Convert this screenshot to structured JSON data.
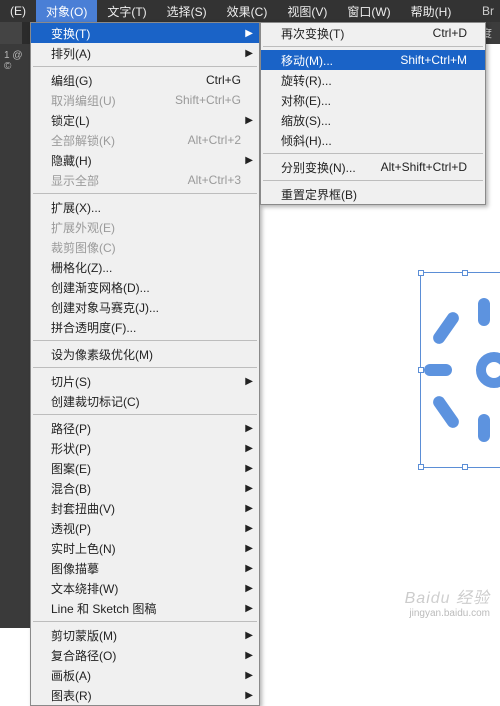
{
  "menubar": {
    "items": [
      {
        "label": "(E)"
      },
      {
        "label": "对象(O)"
      },
      {
        "label": "文字(T)"
      },
      {
        "label": "选择(S)"
      },
      {
        "label": "效果(C)"
      },
      {
        "label": "视图(V)"
      },
      {
        "label": "窗口(W)"
      },
      {
        "label": "帮助(H)"
      }
    ],
    "active_index": 1
  },
  "toolbar": {
    "right_hint_top": "Br",
    "right_hint_mid": "明度",
    "left_text": "1 @ ©"
  },
  "menu1": [
    {
      "type": "item",
      "label": "变换(T)",
      "sub": true,
      "hl": true
    },
    {
      "type": "item",
      "label": "排列(A)",
      "sub": true
    },
    {
      "type": "sep"
    },
    {
      "type": "item",
      "label": "编组(G)",
      "sc": "Ctrl+G"
    },
    {
      "type": "item",
      "label": "取消编组(U)",
      "sc": "Shift+Ctrl+G",
      "disabled": true
    },
    {
      "type": "item",
      "label": "锁定(L)",
      "sub": true
    },
    {
      "type": "item",
      "label": "全部解锁(K)",
      "sc": "Alt+Ctrl+2",
      "disabled": true
    },
    {
      "type": "item",
      "label": "隐藏(H)",
      "sub": true
    },
    {
      "type": "item",
      "label": "显示全部",
      "sc": "Alt+Ctrl+3",
      "disabled": true
    },
    {
      "type": "sep"
    },
    {
      "type": "item",
      "label": "扩展(X)..."
    },
    {
      "type": "item",
      "label": "扩展外观(E)",
      "disabled": true
    },
    {
      "type": "item",
      "label": "裁剪图像(C)",
      "disabled": true
    },
    {
      "type": "item",
      "label": "栅格化(Z)..."
    },
    {
      "type": "item",
      "label": "创建渐变网格(D)..."
    },
    {
      "type": "item",
      "label": "创建对象马赛克(J)..."
    },
    {
      "type": "item",
      "label": "拼合透明度(F)..."
    },
    {
      "type": "sep"
    },
    {
      "type": "item",
      "label": "设为像素级优化(M)"
    },
    {
      "type": "sep"
    },
    {
      "type": "item",
      "label": "切片(S)",
      "sub": true
    },
    {
      "type": "item",
      "label": "创建裁切标记(C)"
    },
    {
      "type": "sep"
    },
    {
      "type": "item",
      "label": "路径(P)",
      "sub": true
    },
    {
      "type": "item",
      "label": "形状(P)",
      "sub": true
    },
    {
      "type": "item",
      "label": "图案(E)",
      "sub": true
    },
    {
      "type": "item",
      "label": "混合(B)",
      "sub": true
    },
    {
      "type": "item",
      "label": "封套扭曲(V)",
      "sub": true
    },
    {
      "type": "item",
      "label": "透视(P)",
      "sub": true
    },
    {
      "type": "item",
      "label": "实时上色(N)",
      "sub": true
    },
    {
      "type": "item",
      "label": "图像描摹",
      "sub": true
    },
    {
      "type": "item",
      "label": "文本绕排(W)",
      "sub": true
    },
    {
      "type": "item",
      "label": "Line 和 Sketch 图稿",
      "sub": true
    },
    {
      "type": "sep"
    },
    {
      "type": "item",
      "label": "剪切蒙版(M)",
      "sub": true
    },
    {
      "type": "item",
      "label": "复合路径(O)",
      "sub": true
    },
    {
      "type": "item",
      "label": "画板(A)",
      "sub": true
    },
    {
      "type": "item",
      "label": "图表(R)",
      "sub": true
    }
  ],
  "menu2": [
    {
      "type": "item",
      "label": "再次变换(T)",
      "sc": "Ctrl+D"
    },
    {
      "type": "sep"
    },
    {
      "type": "item",
      "label": "移动(M)...",
      "sc": "Shift+Ctrl+M",
      "hl": true
    },
    {
      "type": "item",
      "label": "旋转(R)..."
    },
    {
      "type": "item",
      "label": "对称(E)..."
    },
    {
      "type": "item",
      "label": "缩放(S)..."
    },
    {
      "type": "item",
      "label": "倾斜(H)..."
    },
    {
      "type": "sep"
    },
    {
      "type": "item",
      "label": "分别变换(N)...",
      "sc": "Alt+Shift+Ctrl+D"
    },
    {
      "type": "sep"
    },
    {
      "type": "item",
      "label": "重置定界框(B)"
    }
  ],
  "watermark": {
    "brand": "Bai&#x1D48;&#x1D49C; 经验",
    "url": "jingyan.baidu.com"
  }
}
